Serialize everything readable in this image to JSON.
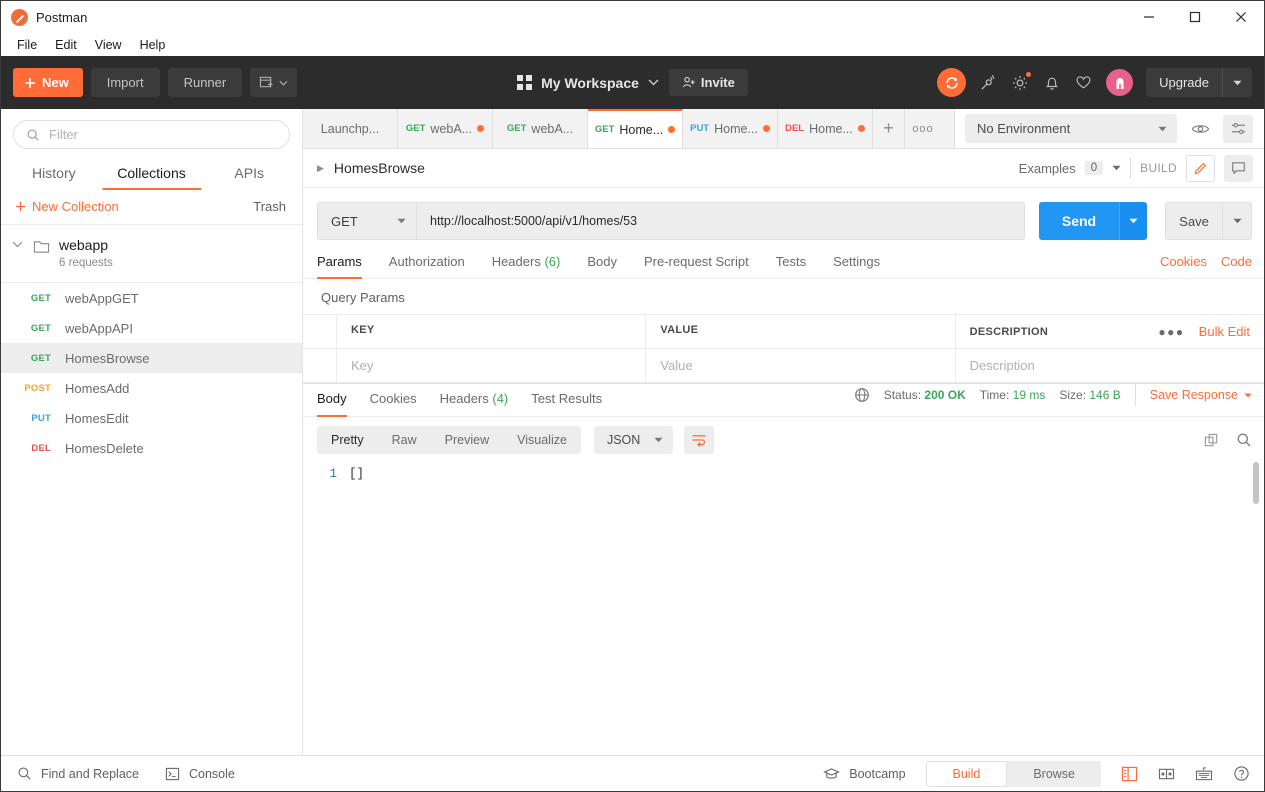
{
  "window": {
    "title": "Postman",
    "minimize": "−",
    "maximize": "□",
    "close": "✕"
  },
  "menubar": [
    "File",
    "Edit",
    "View",
    "Help"
  ],
  "toolbar": {
    "new_label": "New",
    "import_label": "Import",
    "runner_label": "Runner",
    "workspace_name": "My Workspace",
    "invite_label": "Invite",
    "upgrade_label": "Upgrade"
  },
  "sidebar": {
    "filter_placeholder": "Filter",
    "tabs": [
      {
        "label": "History",
        "active": false
      },
      {
        "label": "Collections",
        "active": true
      },
      {
        "label": "APIs",
        "active": false
      }
    ],
    "new_collection_label": "New Collection",
    "trash_label": "Trash",
    "collection": {
      "name": "webapp",
      "subtitle": "6 requests"
    },
    "requests": [
      {
        "method": "GET",
        "name": "webAppGET",
        "selected": false
      },
      {
        "method": "GET",
        "name": "webAppAPI",
        "selected": false
      },
      {
        "method": "GET",
        "name": "HomesBrowse",
        "selected": true
      },
      {
        "method": "POST",
        "name": "HomesAdd",
        "selected": false
      },
      {
        "method": "PUT",
        "name": "HomesEdit",
        "selected": false
      },
      {
        "method": "DEL",
        "name": "HomesDelete",
        "selected": false
      }
    ]
  },
  "tabbar": {
    "tabs": [
      {
        "method": "",
        "label": "Launchp...",
        "active": false,
        "unsaved": false
      },
      {
        "method": "GET",
        "label": "webA...",
        "active": false,
        "unsaved": true
      },
      {
        "method": "GET",
        "label": "webA...",
        "active": false,
        "unsaved": false
      },
      {
        "method": "GET",
        "label": "Home...",
        "active": true,
        "unsaved": true
      },
      {
        "method": "PUT",
        "label": "Home...",
        "active": false,
        "unsaved": true
      },
      {
        "method": "DEL",
        "label": "Home...",
        "active": false,
        "unsaved": true
      }
    ],
    "add_label": "+",
    "more_label": "ooo"
  },
  "environment": {
    "selected": "No Environment"
  },
  "request_header": {
    "name": "HomesBrowse",
    "examples_label": "Examples",
    "examples_count": "0",
    "build_label": "BUILD"
  },
  "request": {
    "method": "GET",
    "url": "http://localhost:5000/api/v1/homes/53",
    "send_label": "Send",
    "save_label": "Save",
    "tabs": [
      {
        "label": "Params",
        "count": "",
        "active": true
      },
      {
        "label": "Authorization",
        "count": "",
        "active": false
      },
      {
        "label": "Headers",
        "count": "(6)",
        "active": false
      },
      {
        "label": "Body",
        "count": "",
        "active": false
      },
      {
        "label": "Pre-request Script",
        "count": "",
        "active": false
      },
      {
        "label": "Tests",
        "count": "",
        "active": false
      },
      {
        "label": "Settings",
        "count": "",
        "active": false
      }
    ],
    "cookies_link": "Cookies",
    "code_link": "Code"
  },
  "query_params": {
    "title": "Query Params",
    "headers": [
      "KEY",
      "VALUE",
      "DESCRIPTION"
    ],
    "bulk_edit_label": "Bulk Edit",
    "rows": [
      {
        "key": "Key",
        "value": "Value",
        "description": "Description"
      }
    ]
  },
  "response": {
    "tabs": [
      {
        "label": "Body",
        "count": "",
        "active": true
      },
      {
        "label": "Cookies",
        "count": "",
        "active": false
      },
      {
        "label": "Headers",
        "count": "(4)",
        "active": false
      },
      {
        "label": "Test Results",
        "count": "",
        "active": false
      }
    ],
    "status_label": "Status:",
    "status_value": "200 OK",
    "time_label": "Time:",
    "time_value": "19 ms",
    "size_label": "Size:",
    "size_value": "146 B",
    "save_response_label": "Save Response",
    "view_modes": [
      {
        "label": "Pretty",
        "active": true
      },
      {
        "label": "Raw",
        "active": false
      },
      {
        "label": "Preview",
        "active": false
      },
      {
        "label": "Visualize",
        "active": false
      }
    ],
    "format": "JSON",
    "body_lines": [
      {
        "number": "1",
        "text": "[]"
      }
    ]
  },
  "statusbar": {
    "find_replace_label": "Find and Replace",
    "console_label": "Console",
    "bootcamp_label": "Bootcamp",
    "modes": [
      {
        "label": "Build",
        "active": true
      },
      {
        "label": "Browse",
        "active": false
      }
    ]
  }
}
